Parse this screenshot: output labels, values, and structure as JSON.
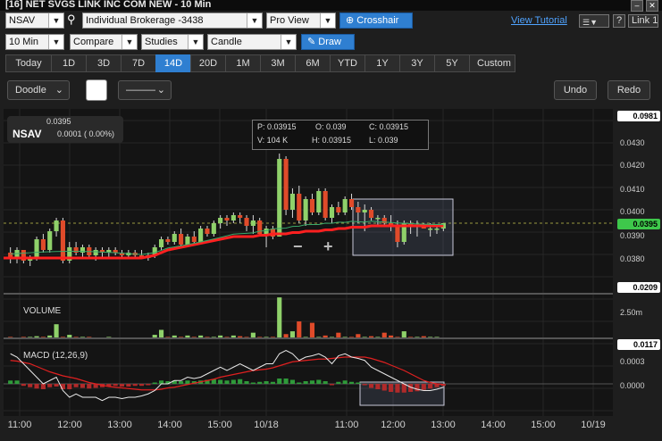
{
  "window": {
    "title": "[16] NET SVGS LINK INC COM NEW - 10 Min"
  },
  "toolbar1": {
    "symbol": "NSAV",
    "account": "Individual Brokerage -3438",
    "view": "Pro View",
    "crosshair": "Crosshair",
    "tutorial": "View Tutorial",
    "help": "?",
    "link": "Link 1"
  },
  "toolbar2": {
    "interval": "10 Min",
    "compare": "Compare",
    "studies": "Studies",
    "chart_style": "Candle",
    "draw": "Draw"
  },
  "ranges": [
    {
      "label": "Today",
      "active": false
    },
    {
      "label": "1D",
      "active": false
    },
    {
      "label": "3D",
      "active": false
    },
    {
      "label": "7D",
      "active": false
    },
    {
      "label": "14D",
      "active": true
    },
    {
      "label": "20D",
      "active": false
    },
    {
      "label": "1M",
      "active": false
    },
    {
      "label": "3M",
      "active": false
    },
    {
      "label": "6M",
      "active": false
    },
    {
      "label": "YTD",
      "active": false
    },
    {
      "label": "1Y",
      "active": false
    },
    {
      "label": "3Y",
      "active": false
    },
    {
      "label": "5Y",
      "active": false
    },
    {
      "label": "Custom",
      "active": false
    }
  ],
  "drawbar": {
    "doodle": "Doodle",
    "line_style": "———",
    "undo": "Undo",
    "redo": "Redo"
  },
  "quote": {
    "symbol": "NSAV",
    "price": "0.0395",
    "change": "0.0001 ( 0.00%)"
  },
  "ohlc": {
    "p": "P: 0.03915",
    "o": "O: 0.039",
    "c": "C: 0.03915",
    "v": "V: 104 K",
    "h": "H: 0.03915",
    "l": "L: 0.039"
  },
  "zoom": {
    "minus": "−",
    "plus": "+"
  },
  "price_axis": {
    "top_box": "0.0981",
    "current_box": "0.0395",
    "bottom_box": "0.0209",
    "ticks": [
      "0.0430",
      "0.0420",
      "0.0410",
      "0.0400",
      "0.0390",
      "0.0380"
    ]
  },
  "volume": {
    "label": "VOLUME",
    "tick": "2.50m",
    "box": "0.0117"
  },
  "macd": {
    "label": "MACD (12,26,9)",
    "tick1": "0.0003",
    "tick2": "0.0000"
  },
  "time_axis": [
    "11:00",
    "12:00",
    "13:00",
    "14:00",
    "15:00",
    "10/18",
    "11:00",
    "12:00",
    "13:00",
    "14:00",
    "15:00",
    "10/19"
  ],
  "colors": {
    "up": "#8fd16a",
    "down": "#e04b2a",
    "ma": "#ff2020",
    "accent": "#2f7fd1",
    "price_box": "#3ec84b"
  },
  "chart_data": {
    "type": "candlestick",
    "interval": "10 Min",
    "ylim": [
      0.0375,
      0.0435
    ],
    "candles": [
      [
        0.0384,
        0.0386,
        0.038,
        0.0382
      ],
      [
        0.0382,
        0.0386,
        0.038,
        0.0385
      ],
      [
        0.0385,
        0.0385,
        0.038,
        0.0381
      ],
      [
        0.0381,
        0.0383,
        0.0379,
        0.0382
      ],
      [
        0.0382,
        0.039,
        0.0381,
        0.0389
      ],
      [
        0.0389,
        0.0391,
        0.0384,
        0.0385
      ],
      [
        0.0385,
        0.0393,
        0.0384,
        0.0392
      ],
      [
        0.0392,
        0.0397,
        0.039,
        0.0396
      ],
      [
        0.0396,
        0.0397,
        0.038,
        0.0381
      ],
      [
        0.0381,
        0.0388,
        0.038,
        0.0386
      ],
      [
        0.0386,
        0.0388,
        0.0383,
        0.0384
      ],
      [
        0.0384,
        0.0387,
        0.0382,
        0.0386
      ],
      [
        0.0386,
        0.0387,
        0.0382,
        0.0383
      ],
      [
        0.0383,
        0.0386,
        0.0381,
        0.0385
      ],
      [
        0.0385,
        0.0386,
        0.0382,
        0.0384
      ],
      [
        0.0384,
        0.0386,
        0.0382,
        0.0385
      ],
      [
        0.0385,
        0.0386,
        0.0383,
        0.0384
      ],
      [
        0.0384,
        0.0385,
        0.0382,
        0.0383
      ],
      [
        0.0383,
        0.0385,
        0.0382,
        0.0384
      ],
      [
        0.0384,
        0.0385,
        0.0382,
        0.0383
      ],
      [
        0.0383,
        0.0385,
        0.0382,
        0.0382
      ],
      [
        0.0382,
        0.0384,
        0.0381,
        0.0383
      ],
      [
        0.0383,
        0.0387,
        0.0382,
        0.0386
      ],
      [
        0.0386,
        0.039,
        0.0385,
        0.0389
      ],
      [
        0.0389,
        0.039,
        0.0387,
        0.0388
      ],
      [
        0.0388,
        0.0392,
        0.0387,
        0.0391
      ],
      [
        0.0391,
        0.0393,
        0.0386,
        0.0387
      ],
      [
        0.0387,
        0.0391,
        0.0386,
        0.039
      ],
      [
        0.039,
        0.0392,
        0.0387,
        0.0388
      ],
      [
        0.0388,
        0.0394,
        0.0387,
        0.0393
      ],
      [
        0.0393,
        0.0394,
        0.039,
        0.0391
      ],
      [
        0.0391,
        0.0396,
        0.039,
        0.0395
      ],
      [
        0.0395,
        0.0398,
        0.0393,
        0.0397
      ],
      [
        0.0397,
        0.0398,
        0.0394,
        0.0396
      ],
      [
        0.0396,
        0.0399,
        0.0395,
        0.0398
      ],
      [
        0.0398,
        0.0399,
        0.0395,
        0.0397
      ],
      [
        0.0397,
        0.0398,
        0.0392,
        0.0394
      ],
      [
        0.0394,
        0.0398,
        0.0391,
        0.0396
      ],
      [
        0.0396,
        0.0397,
        0.039,
        0.0391
      ],
      [
        0.0391,
        0.0394,
        0.0386,
        0.0393
      ],
      [
        0.0393,
        0.0394,
        0.0389,
        0.039
      ],
      [
        0.039,
        0.0421,
        0.039,
        0.0419
      ],
      [
        0.0419,
        0.042,
        0.0398,
        0.04
      ],
      [
        0.04,
        0.0408,
        0.0397,
        0.0406
      ],
      [
        0.0406,
        0.0409,
        0.0395,
        0.0396
      ],
      [
        0.0396,
        0.0405,
        0.0394,
        0.0404
      ],
      [
        0.0404,
        0.0406,
        0.0398,
        0.0399
      ],
      [
        0.0399,
        0.0408,
        0.0398,
        0.0407
      ],
      [
        0.0407,
        0.0408,
        0.0396,
        0.0397
      ],
      [
        0.0397,
        0.0402,
        0.0395,
        0.0401
      ],
      [
        0.0401,
        0.0403,
        0.0398,
        0.0399
      ],
      [
        0.0399,
        0.0405,
        0.0398,
        0.0404
      ],
      [
        0.0404,
        0.0406,
        0.04,
        0.0401
      ],
      [
        0.0401,
        0.0403,
        0.0395,
        0.0399
      ],
      [
        0.0399,
        0.0402,
        0.0392,
        0.04
      ],
      [
        0.04,
        0.0401,
        0.0396,
        0.0397
      ],
      [
        0.0397,
        0.0398,
        0.0394,
        0.0397
      ],
      [
        0.0397,
        0.0398,
        0.0394,
        0.0395
      ],
      [
        0.0395,
        0.0398,
        0.0392,
        0.0394
      ],
      [
        0.0394,
        0.0396,
        0.0386,
        0.0388
      ],
      [
        0.0388,
        0.0396,
        0.0387,
        0.0395
      ],
      [
        0.0395,
        0.0396,
        0.0391,
        0.0394
      ],
      [
        0.0394,
        0.0396,
        0.039,
        0.0394
      ],
      [
        0.0394,
        0.0395,
        0.0393,
        0.0393
      ],
      [
        0.0393,
        0.0395,
        0.039,
        0.0393
      ],
      [
        0.0393,
        0.0394,
        0.0391,
        0.0393
      ],
      [
        0.0393,
        0.0395,
        0.0392,
        0.0395
      ]
    ],
    "moving_average": [
      0.0382,
      0.0382,
      0.0382,
      0.0382,
      0.0382,
      0.0382,
      0.0382,
      0.0382,
      0.0382,
      0.0382,
      0.0382,
      0.0382,
      0.0382,
      0.0382,
      0.0382,
      0.0382,
      0.0382,
      0.0382,
      0.0382,
      0.0382,
      0.0382,
      0.03825,
      0.0383,
      0.0384,
      0.0385,
      0.03855,
      0.0386,
      0.03865,
      0.0387,
      0.03875,
      0.0388,
      0.03885,
      0.0389,
      0.03895,
      0.039,
      0.039,
      0.039,
      0.039,
      0.03905,
      0.03905,
      0.0391,
      0.0391,
      0.0391,
      0.03915,
      0.03915,
      0.0392,
      0.0392,
      0.0392,
      0.03925,
      0.03925,
      0.0393,
      0.0393,
      0.03935,
      0.03935,
      0.03935,
      0.0394,
      0.0394,
      0.0394,
      0.0394,
      0.0394,
      0.0394,
      0.0394,
      0.0394,
      0.0394,
      0.0394,
      0.0394,
      0.0394
    ],
    "volume_ylim": [
      0,
      3.1
    ],
    "volume": [
      0.1,
      0.05,
      0.1,
      0.1,
      0.15,
      0.1,
      0.2,
      1.0,
      0.1,
      0.25,
      0.1,
      0.1,
      0.1,
      0.05,
      0.05,
      0.1,
      0.05,
      0.05,
      0.05,
      0.05,
      0.05,
      0.05,
      0.25,
      0.6,
      0.1,
      0.2,
      0.1,
      0.2,
      0.1,
      0.2,
      0.1,
      0.1,
      0.2,
      0.1,
      0.2,
      0.15,
      0.1,
      0.4,
      0.1,
      0.1,
      0.1,
      2.9,
      0.3,
      0.5,
      1.2,
      0.1,
      1.1,
      0.1,
      0.2,
      0.1,
      0.4,
      0.1,
      0.1,
      0.3,
      0.1,
      0.15,
      0.1,
      0.4,
      0.2,
      0.1,
      0.5,
      0.1,
      0.1,
      0.15,
      0.1,
      0.1,
      0.05
    ],
    "macd_ylim": [
      -0.0004,
      0.0006
    ],
    "macd_line": [
      0.00045,
      0.0004,
      0.0003,
      0.0002,
      0.0001,
      0.0,
      5e-05,
      0.0001,
      -0.0001,
      -0.0002,
      -0.00015,
      -0.0002,
      -0.0002,
      -0.0002,
      -0.00025,
      -0.0002,
      -0.0002,
      -0.00022,
      -0.0002,
      -0.0002,
      -0.00018,
      -0.00015,
      -0.0001,
      0.0,
      0.0,
      5e-05,
      5e-05,
      0.0001,
      8e-05,
      0.0001,
      0.00015,
      0.0002,
      0.00025,
      0.0002,
      0.00025,
      0.0003,
      0.00025,
      0.0002,
      0.00025,
      0.0003,
      0.0003,
      0.00045,
      0.0005,
      0.00045,
      0.00035,
      0.0004,
      0.00042,
      0.00045,
      0.0004,
      0.0003,
      0.00042,
      0.00045,
      0.0004,
      0.00038,
      0.00035,
      0.00025,
      0.0002,
      0.00015,
      0.0001,
      5e-05,
      0.0,
      -5e-05,
      -8e-05,
      -0.0001,
      -0.0001,
      -8e-05,
      -5e-05
    ],
    "signal_line": [
      0.00035,
      0.00034,
      0.00032,
      0.0003,
      0.00026,
      0.00022,
      0.00018,
      0.00015,
      0.00012,
      0.0001,
      8e-05,
      5e-05,
      2e-05,
      0.0,
      -2e-05,
      -4e-05,
      -5e-05,
      -6e-05,
      -7e-05,
      -8e-05,
      -9e-05,
      -9e-05,
      -9e-05,
      -8e-05,
      -6e-05,
      -5e-05,
      -3e-05,
      -1e-05,
      1e-05,
      3e-05,
      5e-05,
      7e-05,
      0.0001,
      0.00012,
      0.00014,
      0.00016,
      0.00018,
      0.0002,
      0.00021,
      0.00022,
      0.00024,
      0.00027,
      0.0003,
      0.00033,
      0.00034,
      0.00035,
      0.00036,
      0.00037,
      0.00037,
      0.00038,
      0.00039,
      0.0004,
      0.0004,
      0.0004,
      0.0004,
      0.00038,
      0.00035,
      0.00032,
      0.00028,
      0.00024,
      0.0002,
      0.00015,
      0.0001,
      5e-05,
      2e-05,
      0.0,
      -1e-05
    ],
    "macd_hist": [
      5e-05,
      5e-05,
      -3e-05,
      -5e-05,
      -7e-05,
      -8e-05,
      -5e-05,
      -4e-05,
      -8e-05,
      -8e-05,
      -5e-05,
      -6e-05,
      -7e-05,
      -6e-05,
      -5e-05,
      -4e-05,
      -3e-05,
      -4e-05,
      -4e-05,
      -3e-05,
      -3e-05,
      -2e-05,
      2e-05,
      5e-05,
      4e-05,
      5e-05,
      4e-05,
      5e-05,
      4e-05,
      5e-05,
      6e-05,
      7e-05,
      6e-05,
      5e-05,
      6e-05,
      7e-05,
      4e-05,
      2e-05,
      3e-05,
      4e-05,
      3e-05,
      8e-05,
      8e-05,
      6e-05,
      2e-05,
      4e-05,
      5e-05,
      6e-05,
      4e-05,
      -2e-05,
      3e-05,
      5e-05,
      3e-05,
      2e-05,
      -2e-05,
      -6e-05,
      -8e-05,
      -0.0001,
      -0.00012,
      -0.00013,
      -0.00013,
      -0.00012,
      -0.00011,
      -9e-05,
      -7e-05,
      -5e-05,
      -3e-05
    ]
  }
}
